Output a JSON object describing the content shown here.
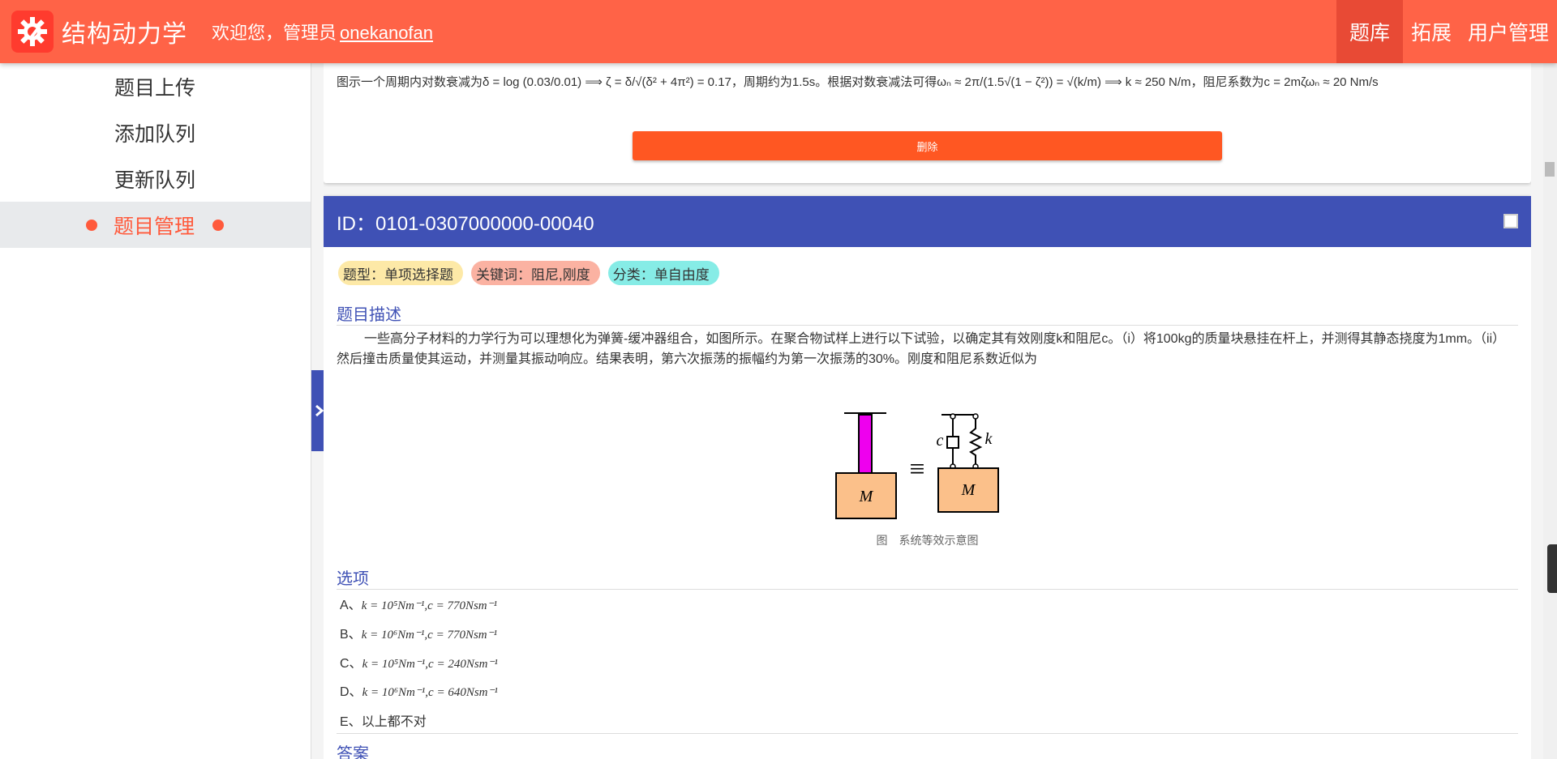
{
  "header": {
    "app_title": "结构动力学",
    "welcome": "欢迎您，管理员",
    "username": "onekanofan",
    "logo_icon": "gear-icon",
    "nav": [
      {
        "label": "题库",
        "active": true
      },
      {
        "label": "拓展",
        "active": false
      },
      {
        "label": "用户管理",
        "active": false
      }
    ]
  },
  "sidebar": {
    "items": [
      {
        "label": "题目上传",
        "active": false
      },
      {
        "label": "添加队列",
        "active": false
      },
      {
        "label": "更新队列",
        "active": false
      },
      {
        "label": "题目管理",
        "active": true
      }
    ],
    "toggle_icon": "chevron-right-icon"
  },
  "prev_card": {
    "analysis": "图示一个周期内对数衰减为δ = log (0.03/0.01) ⟹ ζ = δ/√(δ² + 4π²) = 0.17，周期约为1.5s。根据对数衰减法可得ωₙ ≈ 2π/(1.5√(1 − ζ²)) = √(k/m) ⟹ k ≈ 250 N/m，阻尼系数为c = 2mζωₙ ≈ 20 Nm/s",
    "delete_label": "删除"
  },
  "question": {
    "id_label": "ID：0101-0307000000-00040",
    "tags": {
      "type": "题型：单项选择题",
      "keywords": "关键词：阻尼,刚度",
      "category": "分类：单自由度"
    },
    "description_title": "题目描述",
    "description": "一些高分子材料的力学行为可以理想化为弹簧-缓冲器组合，如图所示。在聚合物试样上进行以下试验，以确定其有效刚度k和阻尼c。（i）将100kg的质量块悬挂在杆上，并测得其静态挠度为1mm。（ii）然后撞击质量使其运动，并测量其振动响应。结果表明，第六次振荡的振幅约为第一次振荡的30%。刚度和阻尼系数近似为",
    "figure": {
      "mass_label": "M",
      "c_label": "c",
      "k_label": "k",
      "equiv": "≡",
      "caption": "图　系统等效示意图"
    },
    "options_title": "选项",
    "options": [
      {
        "prefix": "A、",
        "math": "k = 10⁵Nm⁻¹,c = 770Nsm⁻¹"
      },
      {
        "prefix": "B、",
        "math": "k = 10⁶Nm⁻¹,c = 770Nsm⁻¹"
      },
      {
        "prefix": "C、",
        "math": "k = 10⁵Nm⁻¹,c = 240Nsm⁻¹"
      },
      {
        "prefix": "D、",
        "math": "k = 10⁶Nm⁻¹,c = 640Nsm⁻¹"
      },
      {
        "prefix": "E、",
        "math": "以上都不对"
      }
    ],
    "answer_title": "答案"
  },
  "colors": {
    "header_bg": "#ff6347",
    "accent_blue": "#3f51b5",
    "delete_btn": "#ff5722",
    "sidebar_active": "#ff5a3c"
  }
}
